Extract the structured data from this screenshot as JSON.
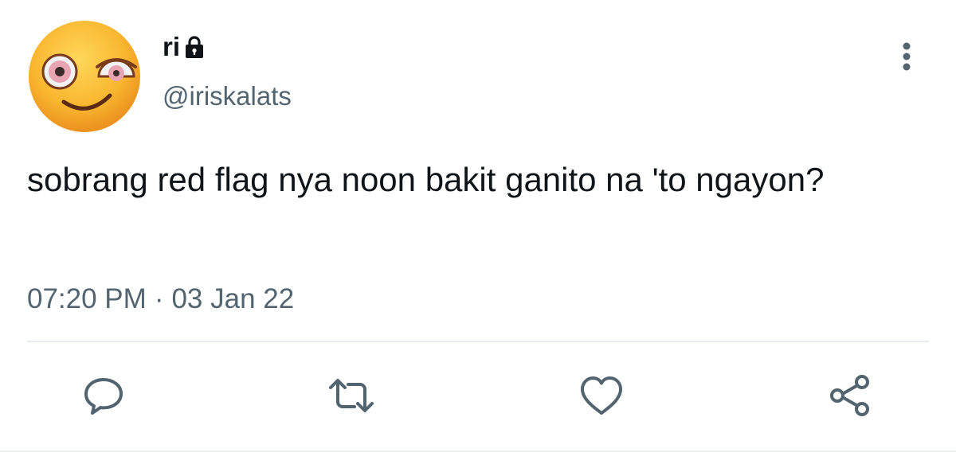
{
  "user": {
    "display_name": "ri",
    "handle": "@iriskalats",
    "protected": true,
    "avatar_icon": "smiling-face-emoji-avatar",
    "lock_icon": "lock-icon"
  },
  "tweet": {
    "text": "sobrang red flag nya noon bakit ganito na 'to ngayon?",
    "time": "07:20 PM",
    "separator": "·",
    "date": "03 Jan 22"
  },
  "actions": [
    {
      "name": "reply",
      "icon": "speech-bubble-icon"
    },
    {
      "name": "retweet",
      "icon": "retweet-arrows-icon"
    },
    {
      "name": "like",
      "icon": "heart-icon"
    },
    {
      "name": "share",
      "icon": "share-nodes-icon"
    }
  ],
  "colors": {
    "text_primary": "#0f1419",
    "text_secondary": "#536471",
    "icon_gray": "#657786",
    "divider": "#e6ecf0",
    "avatar_yellow": "#f6b53a"
  }
}
